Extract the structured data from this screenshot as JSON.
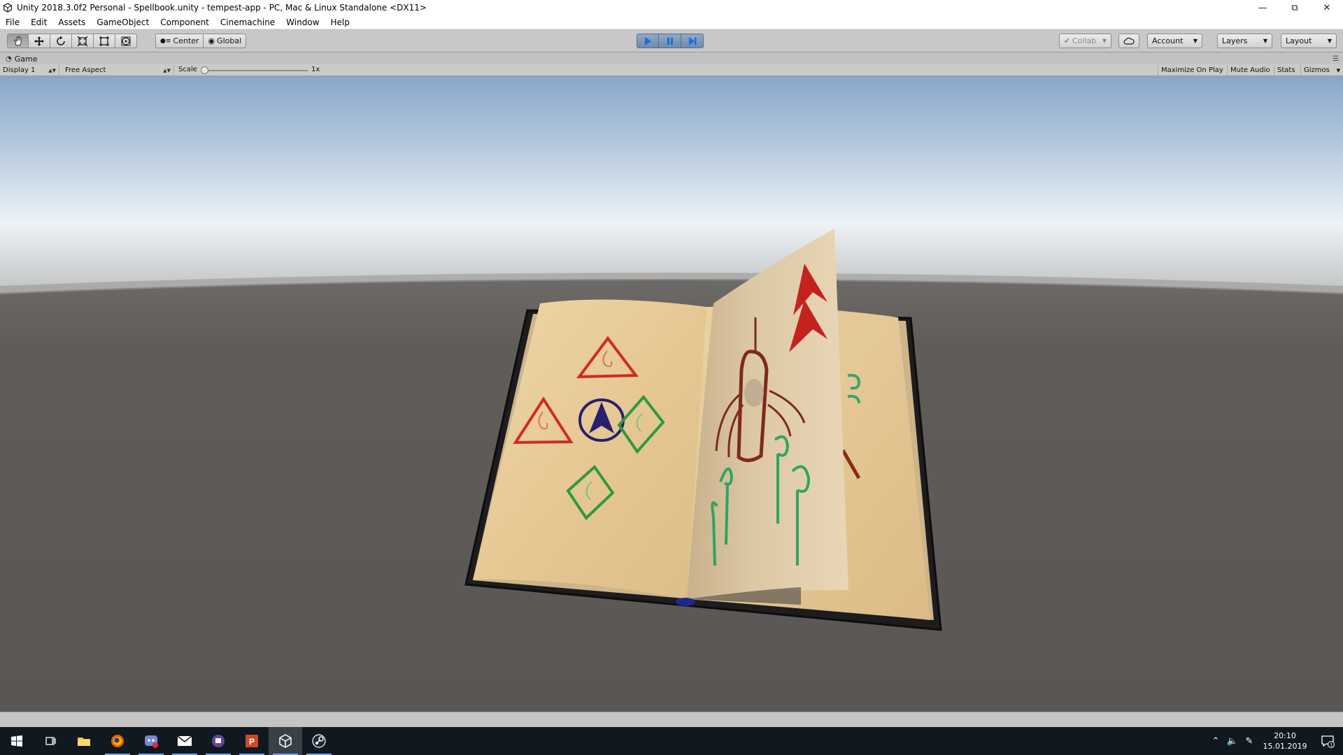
{
  "window": {
    "title": "Unity 2018.3.0f2 Personal - Spellbook.unity - tempest-app - PC, Mac & Linux Standalone <DX11>",
    "controls": [
      "minimize",
      "restore",
      "close"
    ]
  },
  "menu": [
    "File",
    "Edit",
    "Assets",
    "GameObject",
    "Component",
    "Cinemachine",
    "Window",
    "Help"
  ],
  "toolbar": {
    "tools": [
      "hand-tool",
      "move-tool",
      "rotate-tool",
      "scale-tool",
      "rect-tool",
      "transform-tool"
    ],
    "pivot_label": "Center",
    "space_label": "Global",
    "collab_label": "Collab",
    "account_label": "Account",
    "layers_label": "Layers",
    "layout_label": "Layout"
  },
  "game_panel": {
    "tab_label": "Game",
    "display_label": "Display 1",
    "aspect_label": "Free Aspect",
    "scale_label": "Scale",
    "scale_value": "1x",
    "maximize_label": "Maximize On Play",
    "mute_label": "Mute Audio",
    "stats_label": "Stats",
    "gizmos_label": "Gizmos"
  },
  "taskbar": {
    "apps": [
      "start",
      "task-view",
      "file-explorer",
      "firefox",
      "discord",
      "mail",
      "twitch",
      "powerpoint",
      "unity",
      "steam"
    ],
    "time": "20:10",
    "date": "15.01.2019",
    "notification_count": "1"
  },
  "colors": {
    "sky_top": "#8aa6c9",
    "sky_horizon": "#eef3f6",
    "ground": "#5e5a58",
    "page": "#e6c996",
    "red_ink": "#d12a24",
    "green_ink": "#2e9a3c",
    "blue_ink": "#2a1f6e"
  }
}
